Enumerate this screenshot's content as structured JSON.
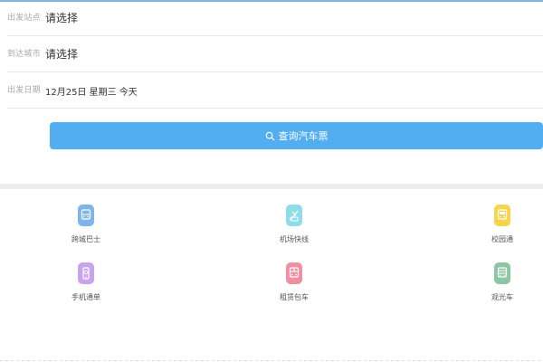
{
  "form": {
    "departure": {
      "label": "出发站点",
      "value": "请选择"
    },
    "destination": {
      "label": "到达城市",
      "value": "请选择"
    },
    "date": {
      "label": "出发日期",
      "value": "12月25日 星期三 今天"
    }
  },
  "search_button": {
    "label": "查询汽车票",
    "icon": "search-icon"
  },
  "services": [
    {
      "label": "跨城巴士",
      "icon": "bus-icon",
      "color": "#7fb6ea"
    },
    {
      "label": "机场快线",
      "icon": "plane-bus-icon",
      "color": "#8fdbe8"
    },
    {
      "label": "校园通",
      "icon": "school-bus-icon",
      "color": "#f8d44c"
    },
    {
      "label": "手机通单",
      "icon": "phone-icon",
      "color": "#c9a4ec"
    },
    {
      "label": "租赁包车",
      "icon": "charter-bus-icon",
      "color": "#f08fa2"
    },
    {
      "label": "观光车",
      "icon": "tour-bus-icon",
      "color": "#8cc7a3"
    }
  ]
}
